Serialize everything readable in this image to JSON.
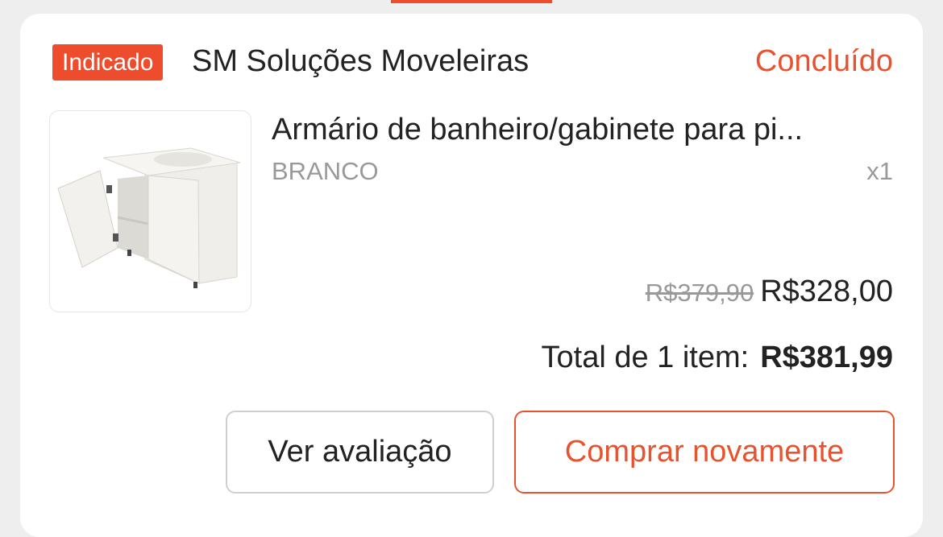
{
  "order": {
    "badge": "Indicado",
    "shop_name": "SM Soluções Moveleiras",
    "status": "Concluído"
  },
  "product": {
    "name": "Armário de banheiro/gabinete para pi...",
    "variant": "BRANCO",
    "quantity": "x1",
    "original_price": "R$379,90",
    "price": "R$328,00"
  },
  "summary": {
    "total_label": "Total de 1 item:",
    "total_value": "R$381,99"
  },
  "actions": {
    "review_label": "Ver avaliação",
    "buy_again_label": "Comprar novamente"
  },
  "colors": {
    "accent": "#ee4d2d",
    "text": "#222222",
    "muted": "#999999"
  }
}
